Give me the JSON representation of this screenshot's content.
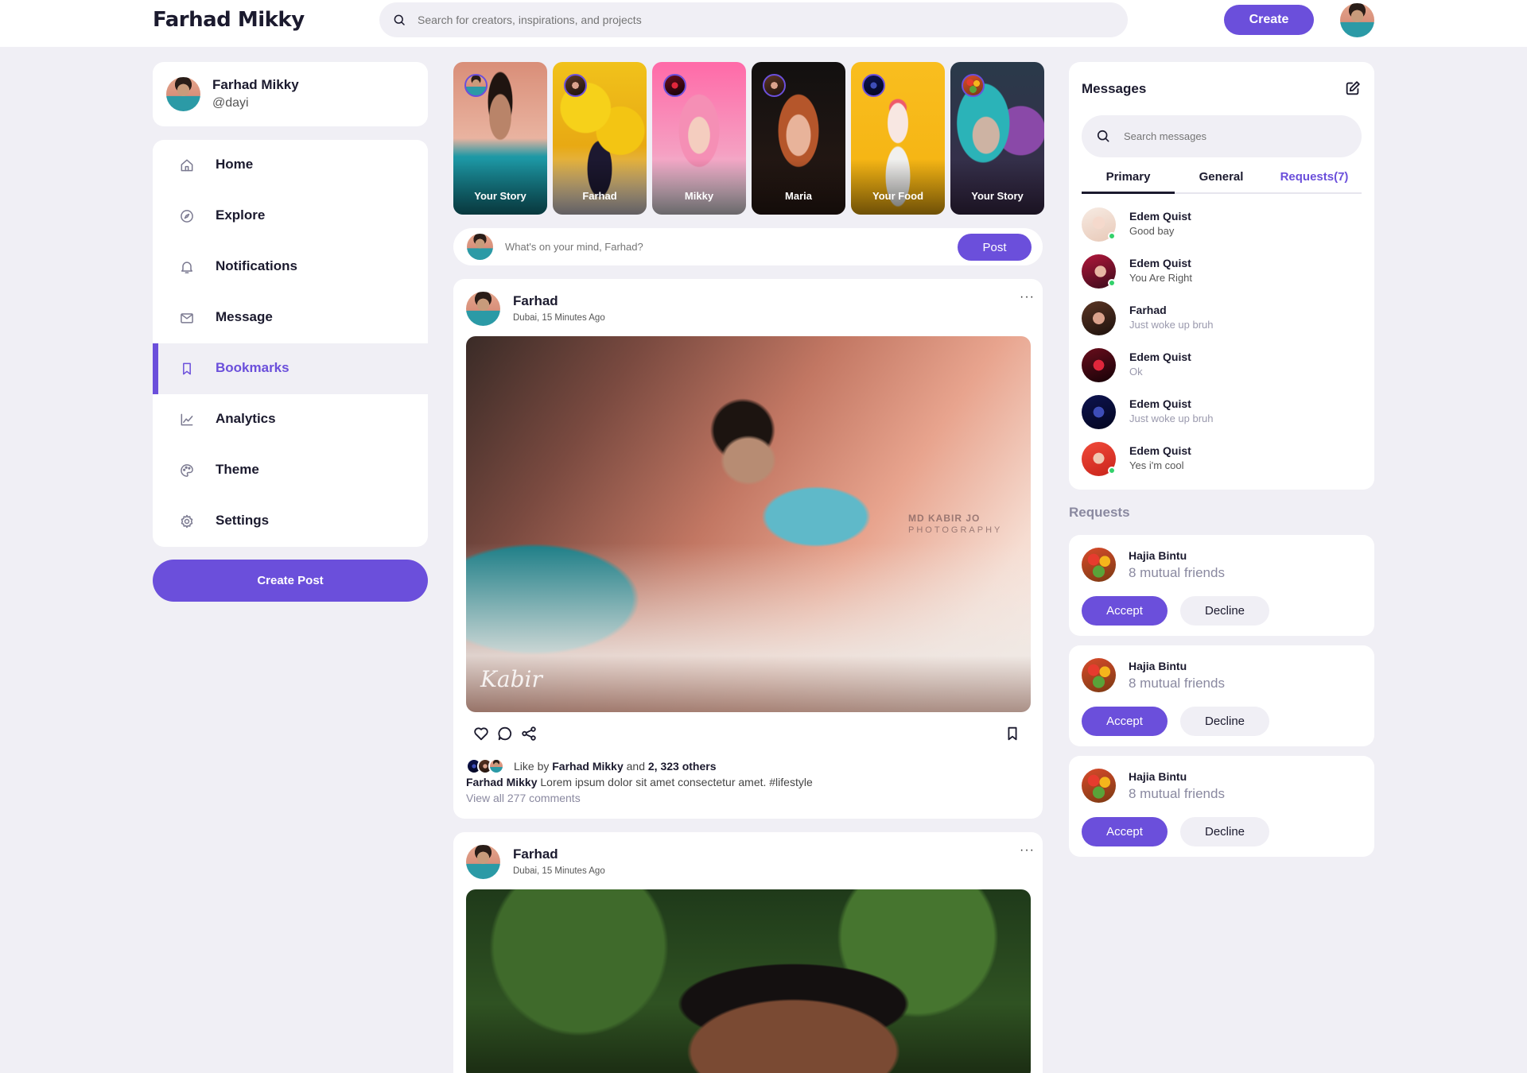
{
  "header": {
    "brand": "Farhad Mikky",
    "search_placeholder": "Search for creators, inspirations, and projects",
    "create_label": "Create"
  },
  "profile": {
    "name": "Farhad Mikky",
    "handle": "@dayi"
  },
  "sidebar": {
    "items": [
      {
        "label": "Home",
        "icon": "home-icon"
      },
      {
        "label": "Explore",
        "icon": "compass-icon"
      },
      {
        "label": "Notifications",
        "icon": "bell-icon"
      },
      {
        "label": "Message",
        "icon": "mail-icon"
      },
      {
        "label": "Bookmarks",
        "icon": "bookmark-icon",
        "active": true
      },
      {
        "label": "Analytics",
        "icon": "chart-icon"
      },
      {
        "label": "Theme",
        "icon": "palette-icon"
      },
      {
        "label": "Settings",
        "icon": "gear-icon"
      }
    ],
    "create_post_label": "Create Post"
  },
  "stories": [
    {
      "label": "Your Story"
    },
    {
      "label": "Farhad"
    },
    {
      "label": "Mikky"
    },
    {
      "label": "Maria"
    },
    {
      "label": "Your Food"
    },
    {
      "label": "Your Story"
    }
  ],
  "composer": {
    "placeholder": "What's on your mind, Farhad?",
    "post_label": "Post"
  },
  "posts": [
    {
      "author": "Farhad",
      "location": "Dubai, 15 Minutes Ago",
      "more": "···",
      "watermark": "MD KABIR JO\nPHOTOGRAPHY",
      "signature": "Kabir",
      "liked_by_prefix": "Like by",
      "liked_by_name": "Farhad Mikky",
      "liked_by_and": "and",
      "liked_by_count": "2, 323 others",
      "caption_author": "Farhad Mikky",
      "caption_text": "Lorem ipsum dolor sit amet consectetur amet. #lifestyle",
      "comments_link": "View all 277 comments"
    },
    {
      "author": "Farhad",
      "location": "Dubai, 15 Minutes Ago",
      "more": "···"
    }
  ],
  "messages": {
    "title": "Messages",
    "search_placeholder": "Search messages",
    "tabs": [
      "Primary",
      "General",
      "Requests(7)"
    ],
    "active_tab": "Primary",
    "items": [
      {
        "name": "Edem Quist",
        "text": "Good bay",
        "online": true
      },
      {
        "name": "Edem Quist",
        "text": "You Are Right",
        "online": true
      },
      {
        "name": "Farhad",
        "text": "Just woke up bruh",
        "online": false
      },
      {
        "name": "Edem Quist",
        "text": "Ok",
        "online": false
      },
      {
        "name": "Edem Quist",
        "text": "Just woke up bruh",
        "online": false
      },
      {
        "name": "Edem Quist",
        "text": "Yes i'm cool",
        "online": true
      }
    ]
  },
  "requests": {
    "title": "Requests",
    "items": [
      {
        "name": "Hajia Bintu",
        "subtitle": "8 mutual friends",
        "accept": "Accept",
        "decline": "Decline"
      },
      {
        "name": "Hajia Bintu",
        "subtitle": "8 mutual friends",
        "accept": "Accept",
        "decline": "Decline"
      },
      {
        "name": "Hajia Bintu",
        "subtitle": "8 mutual friends",
        "accept": "Accept",
        "decline": "Decline"
      }
    ]
  },
  "colors": {
    "accent": "#6b4fdb",
    "background": "#f0eff5",
    "online": "#33d16b"
  }
}
